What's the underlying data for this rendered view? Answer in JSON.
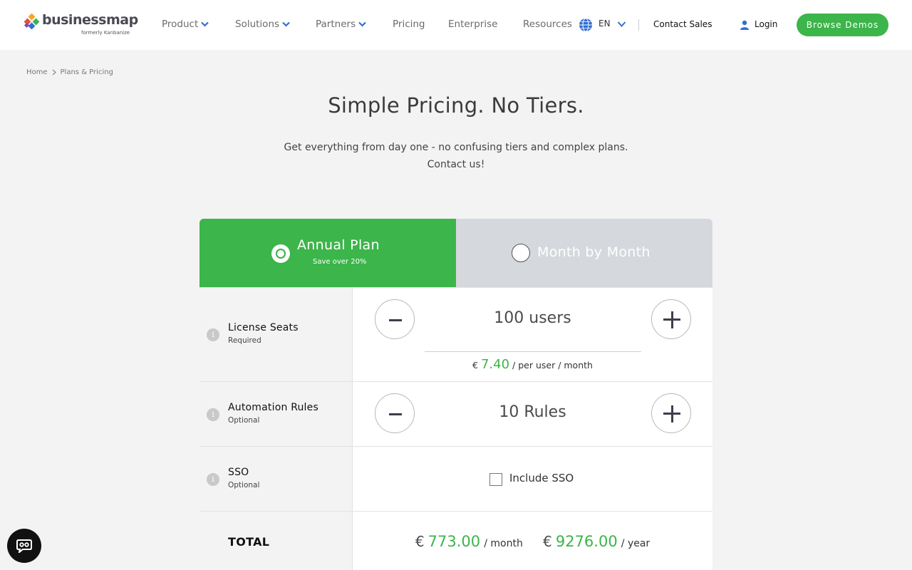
{
  "header": {
    "logo_text": "businessmap",
    "logo_sub": "formerly Kanbanize",
    "nav": [
      {
        "label": "Product",
        "has_dropdown": true
      },
      {
        "label": "Solutions",
        "has_dropdown": true
      },
      {
        "label": "Partners",
        "has_dropdown": true
      },
      {
        "label": "Pricing",
        "has_dropdown": false
      },
      {
        "label": "Enterprise",
        "has_dropdown": false
      },
      {
        "label": "Resources",
        "has_dropdown": true
      }
    ],
    "language": "EN",
    "contact_sales": "Contact Sales",
    "login": "Login",
    "browse_demos": "Browse Demos",
    "accent_color": "#3cb54a"
  },
  "breadcrumb": [
    "Home",
    "Plans & Pricing"
  ],
  "hero": {
    "title": "Simple Pricing. No Tiers.",
    "subtitle_line1": "Get everything from day one - no confusing tiers and complex plans.",
    "subtitle_line2": "Contact us!"
  },
  "plans": {
    "annual": {
      "label": "Annual Plan",
      "note": "Save over 20%",
      "selected": true
    },
    "monthly": {
      "label": "Month by Month",
      "selected": false
    }
  },
  "license": {
    "title": "License Seats",
    "sub": "Required",
    "quantity": "100 users",
    "currency": "€",
    "price": "7.40",
    "price_unit": "/ per user / month"
  },
  "automation": {
    "title": "Automation Rules",
    "sub": "Optional",
    "quantity": "10 Rules"
  },
  "sso": {
    "title": "SSO",
    "sub": "Optional",
    "checkbox_label": "Include SSO",
    "checked": false
  },
  "total": {
    "label": "TOTAL",
    "currency": "€",
    "monthly_amount": "773.00",
    "monthly_unit": "/ month",
    "yearly_amount": "9276.00",
    "yearly_unit": "/ year"
  },
  "info_glyph": "i"
}
